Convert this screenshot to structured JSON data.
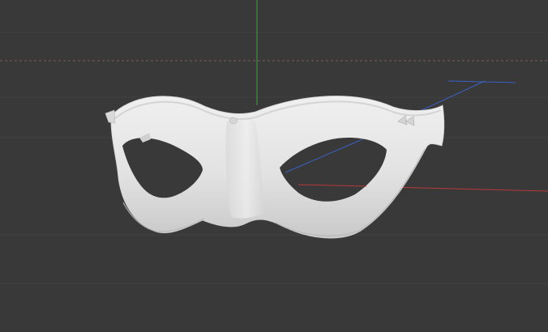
{
  "viewport": {
    "background": "#393939",
    "grid_color": "#414141",
    "axes": {
      "x_color": "#b83a3a",
      "y_color": "#3aa33a",
      "z_color": "#3a62c4"
    },
    "model": {
      "name": "mask",
      "color": "#e6e6e6",
      "shade_color": "#bdbdbd"
    }
  }
}
